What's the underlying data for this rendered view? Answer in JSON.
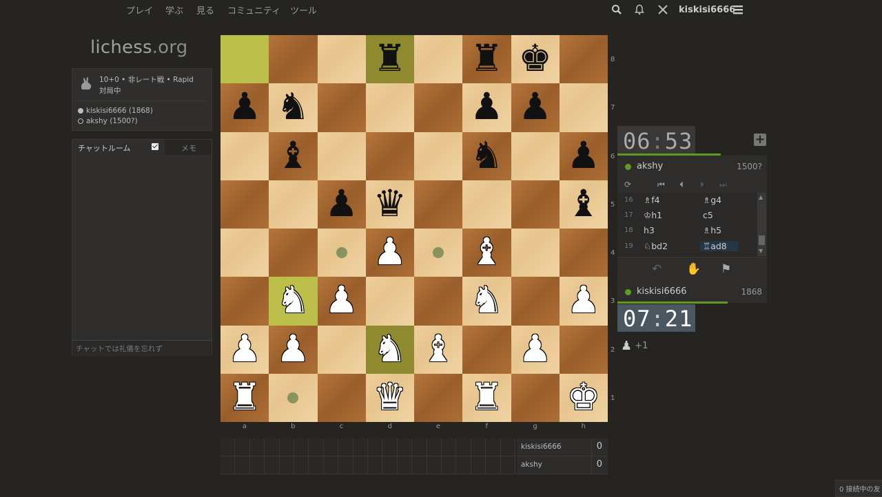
{
  "nav": {
    "items": [
      "プレイ",
      "学ぶ",
      "見る",
      "コミュニティ",
      "ツール"
    ],
    "username": "kiskisi6666",
    "icons": [
      "search-icon",
      "bell-icon",
      "swords-icon",
      "hamburger-icon"
    ]
  },
  "logo": {
    "main": "lichess",
    "tld": ".org"
  },
  "game_info": {
    "line1": "10+0 • 非レート戦 • Rapid",
    "line2": "対局中",
    "white_player": "kiskisi6666 (1868)",
    "black_player": "akshy (1500?)"
  },
  "chat": {
    "tab_chat": "チャットルーム",
    "tab_notes": "メモ",
    "input_placeholder": "チャットでは礼儀を忘れず"
  },
  "board": {
    "ranks": [
      "8",
      "7",
      "6",
      "5",
      "4",
      "3",
      "2",
      "1"
    ],
    "files": [
      "a",
      "b",
      "c",
      "d",
      "e",
      "f",
      "g",
      "h"
    ],
    "position": [
      [
        "",
        "",
        "",
        "bR",
        "",
        "bR",
        "bK",
        ""
      ],
      [
        "bP",
        "bN",
        "",
        "",
        "",
        "bP",
        "bP",
        ""
      ],
      [
        "",
        "bB",
        "",
        "",
        "",
        "bN",
        "",
        "bP"
      ],
      [
        "",
        "",
        "bP",
        "bQ",
        "",
        "",
        "",
        "bB"
      ],
      [
        "",
        "",
        "",
        "wP",
        "",
        "wB",
        "",
        ""
      ],
      [
        "",
        "wN",
        "wP",
        "",
        "",
        "wN",
        "",
        "wP"
      ],
      [
        "wP",
        "wP",
        "",
        "wN",
        "wB",
        "",
        "wP",
        ""
      ],
      [
        "wR",
        "",
        "",
        "wQ",
        "",
        "wR",
        "",
        "wK"
      ]
    ],
    "last_move_squares": [
      "a8",
      "d8"
    ],
    "selected_square": "b3",
    "ghost_square": "d2",
    "move_hints": [
      "c4",
      "e4",
      "b1"
    ]
  },
  "clocks": {
    "top": "06:53",
    "bottom": "07:21",
    "top_min": "06",
    "top_sec": "53",
    "bottom_min": "07",
    "bottom_sec": "21"
  },
  "players": {
    "top": {
      "name": "akshy",
      "rating": "1500?"
    },
    "bottom": {
      "name": "kiskisi6666",
      "rating": "1868"
    }
  },
  "moves": [
    {
      "num": "16",
      "white": "♗f4",
      "black": "♗g4"
    },
    {
      "num": "17",
      "white": "♔h1",
      "black": "c5"
    },
    {
      "num": "18",
      "white": "h3",
      "black": "♗h5"
    },
    {
      "num": "19",
      "white": "♘bd2",
      "black": "♖ad8"
    }
  ],
  "material": {
    "piece": "♟",
    "diff": "+1"
  },
  "score": [
    {
      "name": "kiskisi6666",
      "value": "0"
    },
    {
      "name": "akshy",
      "value": "0"
    }
  ],
  "friends": {
    "label": "0 接続中の友"
  },
  "colors": {
    "background": "#262421",
    "accent_green": "#629924",
    "clock_active": "#4a5761"
  }
}
